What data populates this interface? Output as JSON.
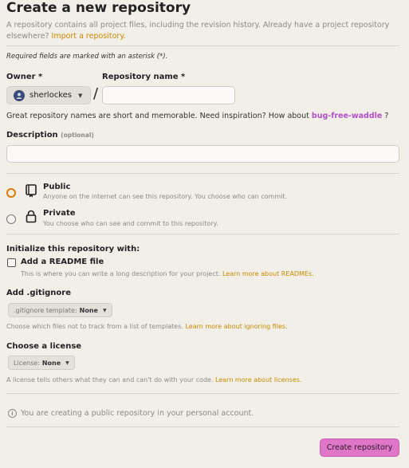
{
  "header": {
    "title": "Create a new repository",
    "intro_text": "A repository contains all project files, including the revision history. Already have a project repository elsewhere?",
    "import_link": "Import a repository."
  },
  "required_note": "Required fields are marked with an asterisk (*).",
  "owner": {
    "label": "Owner *",
    "value": "sherlockes"
  },
  "repo_name": {
    "label": "Repository name *",
    "value": ""
  },
  "name_hint": {
    "text": "Great repository names are short and memorable. Need inspiration? How about",
    "suggestion": "bug-free-waddle",
    "suffix": "?"
  },
  "description": {
    "label": "Description",
    "optional": "(optional)",
    "value": ""
  },
  "visibility": {
    "public": {
      "title": "Public",
      "subtitle": "Anyone on the internet can see this repository. You choose who can commit.",
      "selected": true
    },
    "private": {
      "title": "Private",
      "subtitle": "You choose who can see and commit to this repository.",
      "selected": false
    }
  },
  "initialize": {
    "heading": "Initialize this repository with:",
    "readme": {
      "label": "Add a README file",
      "checked": false,
      "note": "This is where you can write a long description for your project.",
      "link": "Learn more about READMEs."
    }
  },
  "gitignore": {
    "heading": "Add .gitignore",
    "select_prefix": ".gitignore template:",
    "select_value": "None",
    "note": "Choose which files not to track from a list of templates.",
    "link": "Learn more about ignoring files."
  },
  "license": {
    "heading": "Choose a license",
    "select_prefix": "License:",
    "select_value": "None",
    "note": "A license tells others what they can and can't do with your code.",
    "link": "Learn more about licenses."
  },
  "info_message": "You are creating a public repository in your personal account.",
  "create_button": "Create repository",
  "colors": {
    "background": "#f2efe9",
    "link": "#c68a00",
    "suggestion": "#b24fc7",
    "radio_selected": "#e07a00",
    "primary_button": "#e076c8"
  },
  "icons": {
    "public": "repo-book-icon",
    "private": "lock-icon",
    "info": "info-icon",
    "caret": "chevron-down-icon"
  }
}
